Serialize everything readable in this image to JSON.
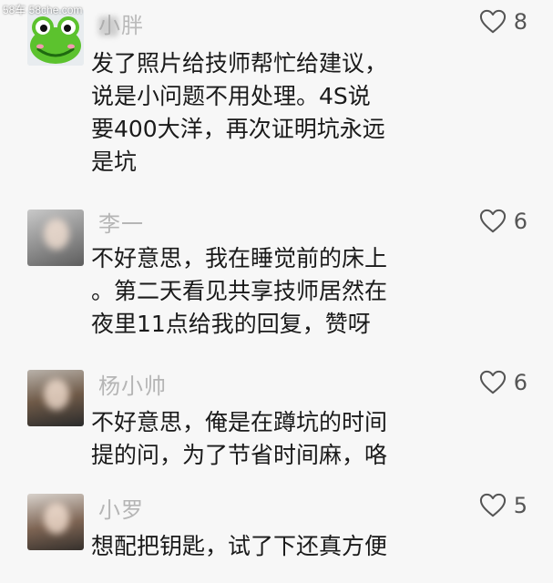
{
  "watermark": "58车 58che.com",
  "comments": [
    {
      "name": "小胖",
      "likes": "8",
      "lines": [
        "发了照片给技师帮忙给建议，",
        "说是小问题不用处理。4S说",
        "要400大洋，再次证明坑永远",
        "是坑"
      ]
    },
    {
      "name": "李一",
      "likes": "6",
      "lines": [
        "不好意思，我在睡觉前的床上",
        "。第二天看见共享技师居然在",
        "夜里11点给我的回复，赞呀"
      ]
    },
    {
      "name": "杨小帅",
      "likes": "6",
      "lines": [
        "不好意思，俺是在蹲坑的时间",
        "提的问，为了节省时间麻，咯"
      ]
    },
    {
      "name": "小罗",
      "likes": "5",
      "lines": [
        "想配把钥匙，试了下还真方便"
      ]
    }
  ],
  "colors": {
    "background": "#f7f7f7",
    "name_text": "#9a9a9a",
    "body_text": "#1a1a1a",
    "like_icon": "#555555",
    "frog_green": "#5cc22e"
  },
  "icons": {
    "like": "heart-outline-icon",
    "avatar_1": "frog-avatar"
  }
}
